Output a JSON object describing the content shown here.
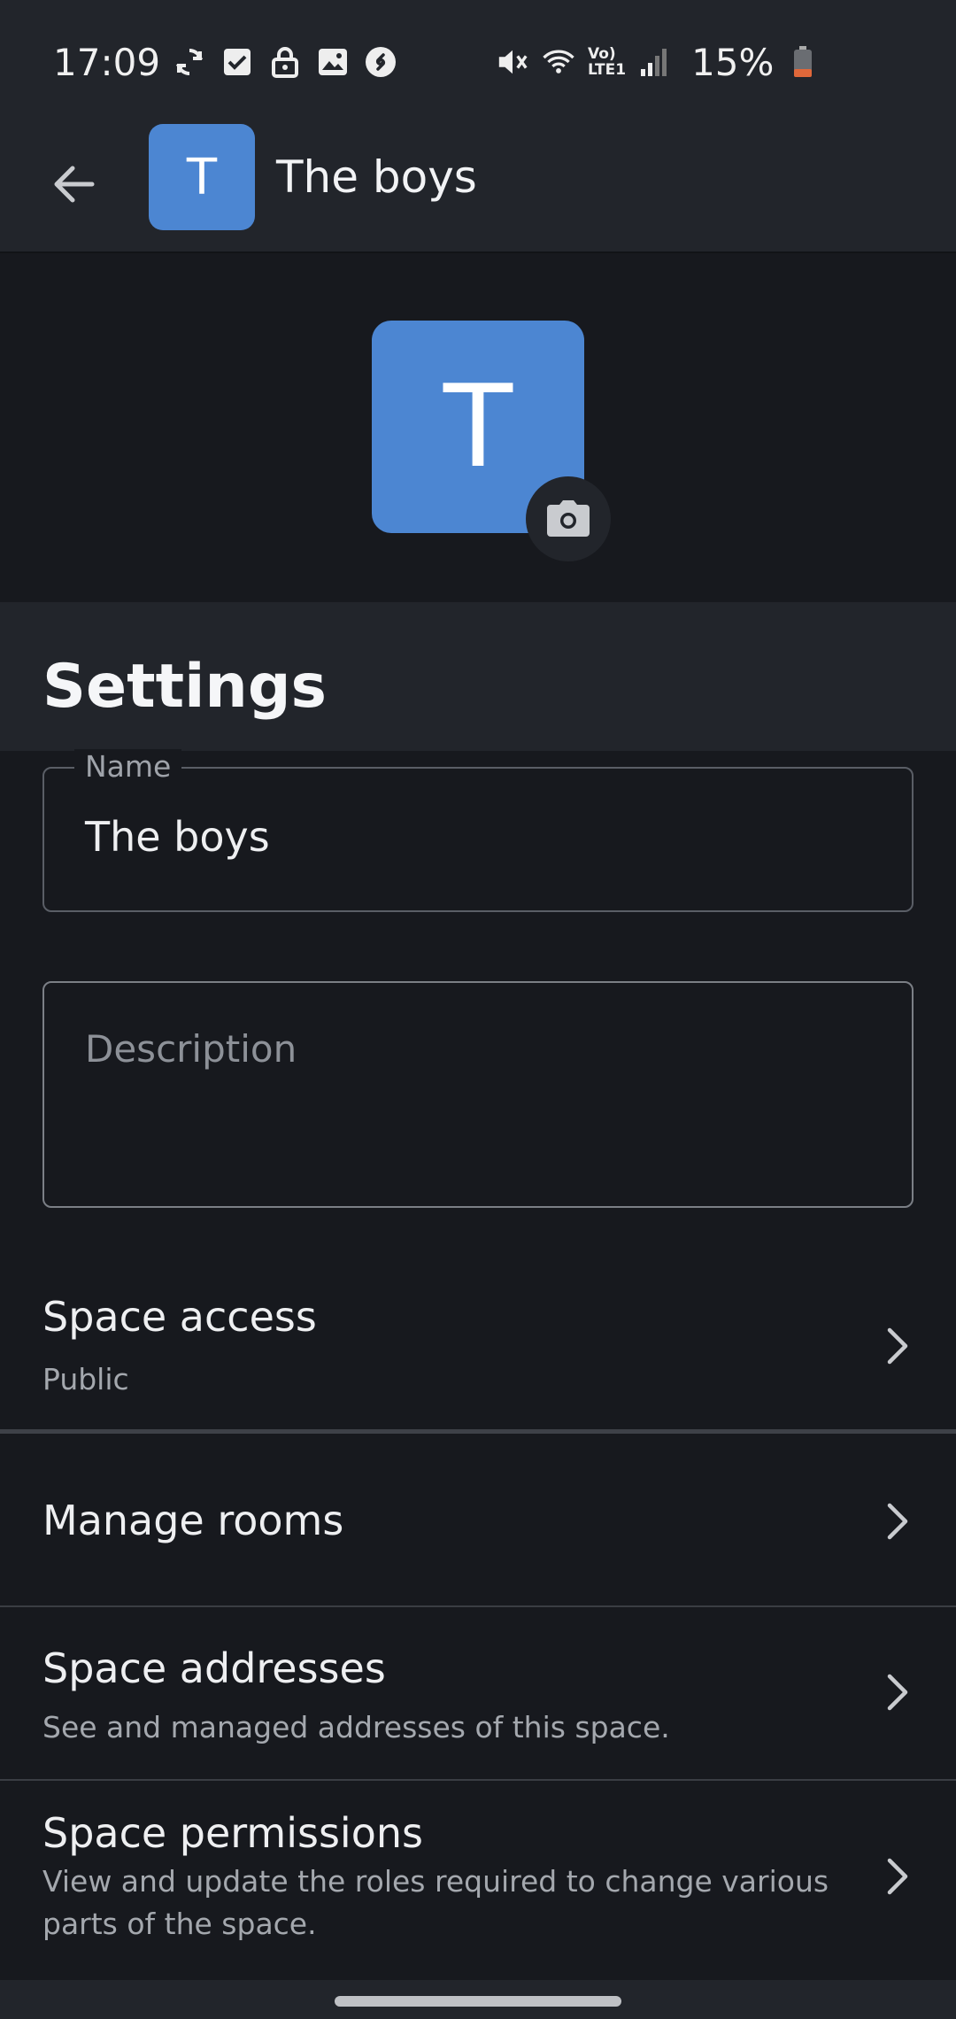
{
  "status_bar": {
    "time": "17:09",
    "battery": "15%",
    "network_label_top": "Vo)",
    "network_label_bottom": "LTE1"
  },
  "app_bar": {
    "avatar_letter": "T",
    "title": "The boys"
  },
  "hero": {
    "avatar_letter": "T"
  },
  "settings": {
    "heading": "Settings",
    "name_field": {
      "label": "Name",
      "value": "The boys"
    },
    "description_field": {
      "placeholder": "Description",
      "value": ""
    },
    "items": [
      {
        "title": "Space access",
        "subtitle": "Public"
      },
      {
        "title": "Manage rooms",
        "subtitle": ""
      },
      {
        "title": "Space addresses",
        "subtitle": "See and managed addresses of this space."
      },
      {
        "title": "Space permissions",
        "subtitle": "View and update the roles required to change various parts of the space."
      }
    ]
  },
  "colors": {
    "accent": "#4c86d2",
    "surface": "#22252b",
    "background": "#17191e",
    "battery_low": "#e0683a"
  }
}
